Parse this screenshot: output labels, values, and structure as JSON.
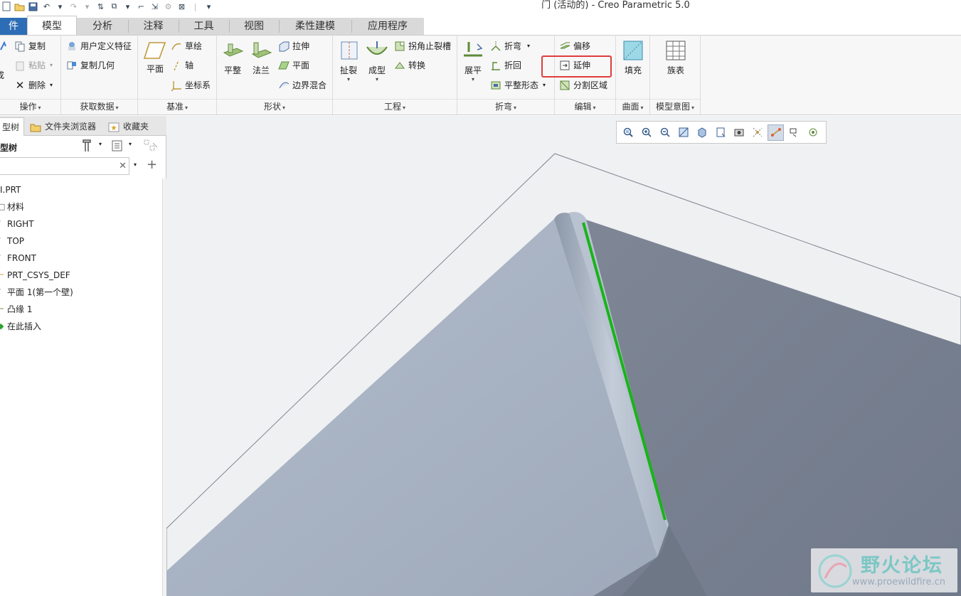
{
  "window": {
    "title": "门 (活动的) - Creo Parametric 5.0"
  },
  "tabs": [
    {
      "label": "件"
    },
    {
      "label": "模型"
    },
    {
      "label": "分析"
    },
    {
      "label": "注释"
    },
    {
      "label": "工具"
    },
    {
      "label": "视图"
    },
    {
      "label": "柔性建模"
    },
    {
      "label": "应用程序"
    }
  ],
  "ribbon": {
    "operations": {
      "label": "操作",
      "items": [
        "成",
        "复制",
        "粘贴",
        "删除"
      ]
    },
    "getdata": {
      "label": "获取数据",
      "items": [
        "用户定义特征",
        "复制几何"
      ]
    },
    "datum": {
      "label": "基准",
      "plane": "平面",
      "items": [
        "草绘",
        "轴",
        "坐标系"
      ]
    },
    "shapes": {
      "label": "形状",
      "flat": "平整",
      "flange": "法兰",
      "items": [
        "拉伸",
        "平面",
        "边界混合"
      ]
    },
    "engineering": {
      "label": "工程",
      "rip": "扯裂",
      "form": "成型",
      "items": [
        "拐角止裂槽",
        "转换"
      ]
    },
    "bends": {
      "label": "折弯",
      "unbend": "展平",
      "items": [
        "折弯",
        "折回",
        "平整形态"
      ]
    },
    "editing": {
      "label": "编辑",
      "items": [
        "偏移",
        "延伸",
        "分割区域"
      ]
    },
    "surfaces": {
      "label": "曲面",
      "fill": "填充"
    },
    "intent": {
      "label": "模型意图",
      "family": "族表"
    }
  },
  "panel": {
    "tabs": [
      "型树",
      "文件夹浏览器",
      "收藏夹"
    ],
    "header": "型树",
    "tree": [
      "I.PRT",
      "材料",
      "RIGHT",
      "TOP",
      "FRONT",
      "PRT_CSYS_DEF",
      "平面 1(第一个壁)",
      "凸缘 1",
      "在此插入"
    ]
  },
  "watermark": {
    "name": "野火论坛",
    "url": "www.proewildfire.cn"
  },
  "colors": {
    "file_tab": "#2d6db5",
    "highlight": "#e03c3c",
    "selected_edge": "#19b419"
  }
}
